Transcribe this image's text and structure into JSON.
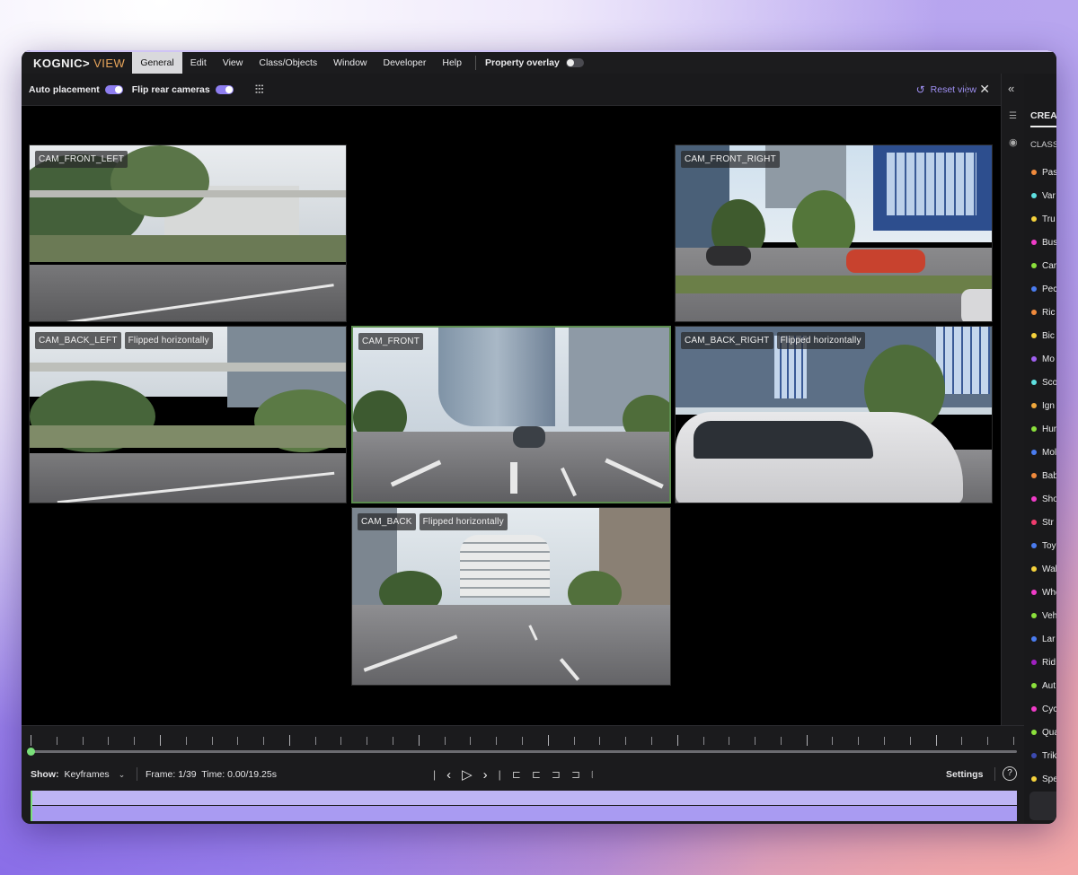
{
  "app": {
    "brand": "KOGNIC",
    "brand_sep": ">",
    "brand_suffix": "VIEW"
  },
  "menu": {
    "items": [
      "General",
      "Edit",
      "View",
      "Class/Objects",
      "Window",
      "Developer",
      "Help"
    ],
    "active": "General",
    "property_overlay_label": "Property overlay",
    "property_overlay_on": false
  },
  "toolbar": {
    "auto_placement_label": "Auto placement",
    "auto_placement_on": true,
    "flip_rear_label": "Flip rear cameras",
    "flip_rear_on": true,
    "reset_view_label": "Reset view"
  },
  "cameras": [
    {
      "id": "cam-front-left",
      "name": "CAM_FRONT_LEFT",
      "note": ""
    },
    {
      "id": "cam-front-right",
      "name": "CAM_FRONT_RIGHT",
      "note": ""
    },
    {
      "id": "cam-back-left",
      "name": "CAM_BACK_LEFT",
      "note": "Flipped horizontally"
    },
    {
      "id": "cam-front",
      "name": "CAM_FRONT",
      "note": ""
    },
    {
      "id": "cam-back-right",
      "name": "CAM_BACK_RIGHT",
      "note": "Flipped horizontally"
    },
    {
      "id": "cam-back",
      "name": "CAM_BACK",
      "note": "Flipped horizontally"
    }
  ],
  "right_panel": {
    "tab_label": "CREAT",
    "classes_label": "CLASS",
    "classes": [
      {
        "label": "Pas",
        "color": "#f08a3c"
      },
      {
        "label": "Var",
        "color": "#5ee0e0"
      },
      {
        "label": "Tru",
        "color": "#f5d23c"
      },
      {
        "label": "Bus",
        "color": "#f03cc8"
      },
      {
        "label": "Car",
        "color": "#8be03c"
      },
      {
        "label": "Pec",
        "color": "#4a7cf0"
      },
      {
        "label": "Ric",
        "color": "#f08a3c"
      },
      {
        "label": "Bic",
        "color": "#f5d23c"
      },
      {
        "label": "Mo",
        "color": "#a060f0"
      },
      {
        "label": "Sco",
        "color": "#5ee0e0"
      },
      {
        "label": "Ign",
        "color": "#f0a83c"
      },
      {
        "label": "Hur",
        "color": "#8be03c"
      },
      {
        "label": "Mol",
        "color": "#4a7cf0"
      },
      {
        "label": "Bab",
        "color": "#f08a3c"
      },
      {
        "label": "Sho",
        "color": "#f03cc8"
      },
      {
        "label": "Str",
        "color": "#f03c6e"
      },
      {
        "label": "Toy",
        "color": "#4a7cf0"
      },
      {
        "label": "Wal",
        "color": "#f5d23c"
      },
      {
        "label": "Whe",
        "color": "#f03cc8"
      },
      {
        "label": "Veh",
        "color": "#8be03c"
      },
      {
        "label": "Lar",
        "color": "#4a7cf0"
      },
      {
        "label": "Rid",
        "color": "#a020c0"
      },
      {
        "label": "Aut",
        "color": "#8be03c"
      },
      {
        "label": "Cyc",
        "color": "#f03cc8"
      },
      {
        "label": "Qua",
        "color": "#8be03c"
      },
      {
        "label": "Trik",
        "color": "#3c4ab0"
      },
      {
        "label": "Spe",
        "color": "#f5d23c"
      }
    ]
  },
  "timeline": {
    "show_label": "Show:",
    "show_value": "Keyframes",
    "frame_label": "Frame:",
    "frame_value": "1/39",
    "time_label": "Time:",
    "time_value": "0.00/19.25s",
    "settings_label": "Settings",
    "help_label": "?",
    "progress": 0.0
  }
}
